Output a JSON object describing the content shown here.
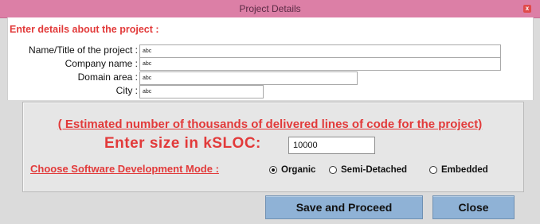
{
  "window": {
    "title": "Project Details",
    "close_glyph": "x",
    "colors": {
      "titlebar": "#dc7fa6",
      "accent_text": "#e23a3a",
      "button": "#8fb2d6"
    }
  },
  "form": {
    "heading": "Enter details about the project :",
    "fields": [
      {
        "label": "Name/Title of the project :",
        "value": "abc"
      },
      {
        "label": "Company name :",
        "value": "abc"
      },
      {
        "label": "Domain area :",
        "value": "abc"
      },
      {
        "label": "City :",
        "value": "abc"
      }
    ]
  },
  "estimation": {
    "note": "( Estimated number of thousands of delivered lines of code for the project)",
    "size_label": "Enter size in kSLOC:",
    "size_value": "10000",
    "mode_label": "Choose Software Development Mode :",
    "modes": [
      {
        "label": "Organic",
        "selected": true
      },
      {
        "label": "Semi-Detached",
        "selected": false
      },
      {
        "label": "Embedded",
        "selected": false
      }
    ]
  },
  "buttons": {
    "save_label": "Save and Proceed",
    "close_label": "Close"
  }
}
